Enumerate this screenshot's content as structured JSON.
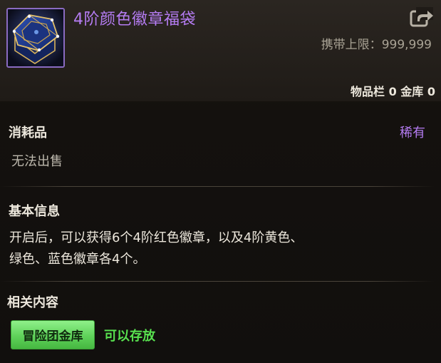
{
  "item": {
    "name": "4阶颜色徽章福袋",
    "icon": "badge-chest-icon",
    "carry_limit_label": "携带上限：",
    "carry_limit_value": "999,999",
    "storage_label": "物品栏 0 金库 0"
  },
  "category": {
    "type": "消耗品",
    "rarity": "稀有",
    "sell_note": "无法出售"
  },
  "basic_info": {
    "title": "基本信息",
    "line1": "开启后，可以获得6个4阶红色徽章，以及4阶黄色、",
    "line2": "绿色、蓝色徽章各4个。"
  },
  "related": {
    "title": "相关内容",
    "tag_label": "冒险团金库",
    "tag_status": "可以存放"
  },
  "colors": {
    "name_purple": "#b57cf2",
    "status_green": "#58e04f",
    "tag_green": "#5fd25a"
  }
}
